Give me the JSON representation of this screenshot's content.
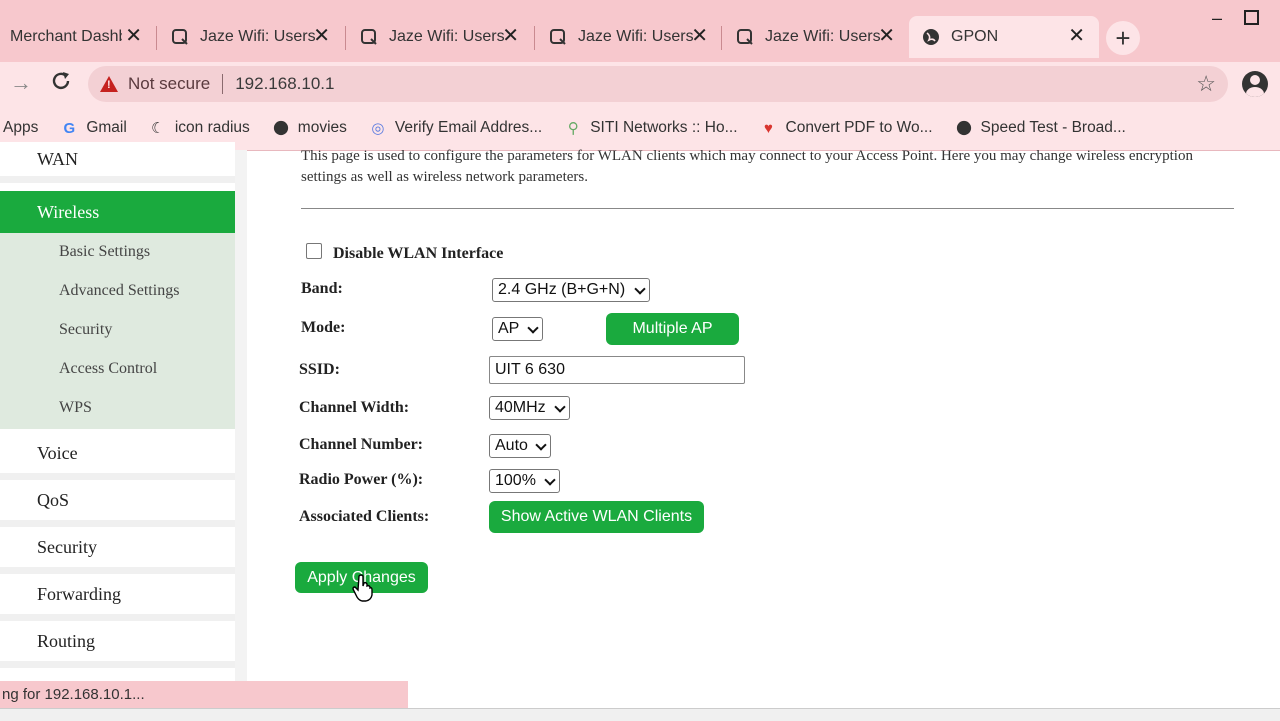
{
  "browser": {
    "tabs": [
      {
        "title": "Merchant Dashboard",
        "icon": "merchant-icon",
        "active": false
      },
      {
        "title": "Jaze Wifi: Users",
        "icon": "jaze-icon",
        "active": false
      },
      {
        "title": "Jaze Wifi: Users",
        "icon": "jaze-icon",
        "active": false
      },
      {
        "title": "Jaze Wifi: Users",
        "icon": "jaze-icon",
        "active": false
      },
      {
        "title": "Jaze Wifi: Users",
        "icon": "jaze-icon",
        "active": false
      },
      {
        "title": "GPON",
        "icon": "globe-icon",
        "active": true
      }
    ],
    "address": {
      "security_label": "Not secure",
      "url": "192.168.10.1"
    },
    "bookmarks": [
      {
        "label": "Apps",
        "icon": "apps-icon"
      },
      {
        "label": "Gmail",
        "icon": "google-icon"
      },
      {
        "label": "icon radius",
        "icon": "radius-icon"
      },
      {
        "label": "movies",
        "icon": "globe-icon"
      },
      {
        "label": "Verify Email Addres...",
        "icon": "verify-icon"
      },
      {
        "label": "SITI Networks :: Ho...",
        "icon": "siti-icon"
      },
      {
        "label": "Convert PDF to Wo...",
        "icon": "heart-icon"
      },
      {
        "label": "Speed Test - Broad...",
        "icon": "globe-icon"
      }
    ],
    "status_text": "ng for 192.168.10.1..."
  },
  "sidebar": {
    "items": [
      {
        "label": "WAN"
      },
      {
        "label": "Wireless"
      },
      {
        "label": "Voice"
      },
      {
        "label": "QoS"
      },
      {
        "label": "Security"
      },
      {
        "label": "Forwarding"
      },
      {
        "label": "Routing"
      }
    ],
    "submenu": [
      "Basic Settings",
      "Advanced Settings",
      "Security",
      "Access Control",
      "WPS"
    ]
  },
  "form": {
    "description": "This page is used to configure the parameters for WLAN clients which may connect to your Access Point. Here you may change wireless encryption settings as well as wireless network parameters.",
    "disable_label": "Disable WLAN Interface",
    "band_label": "Band:",
    "band_value": "2.4 GHz (B+G+N)",
    "mode_label": "Mode:",
    "mode_value": "AP",
    "multiple_ap_label": "Multiple AP",
    "ssid_label": "SSID:",
    "ssid_value": "UIT 6 630",
    "channel_width_label": "Channel Width:",
    "channel_width_value": "40MHz",
    "channel_number_label": "Channel Number:",
    "channel_number_value": "Auto",
    "radio_power_label": "Radio Power (%):",
    "radio_power_value": "100%",
    "clients_label": "Associated Clients:",
    "show_clients_label": "Show Active WLAN Clients",
    "apply_label": "Apply Changes"
  },
  "colors": {
    "accent": "#1aaa3e",
    "chrome": "#f7c8cd",
    "chrome_light": "#fde4e7"
  }
}
